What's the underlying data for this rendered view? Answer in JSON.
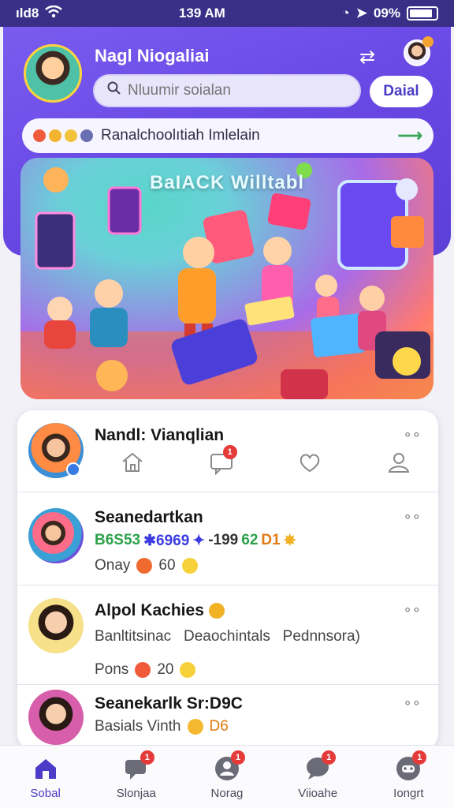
{
  "status_bar": {
    "time": "139 AM",
    "left": "ıld8",
    "battery": "09%"
  },
  "header": {
    "user_name": "Nagl Niogaliai",
    "search_placeholder": "Nluumir soialan",
    "deal_label": "Daial",
    "announcement": "Ranalchoolıtiah Imlelain"
  },
  "banner": {
    "title": "BaIACK Willtabl"
  },
  "feed": {
    "rows": [
      {
        "name": "Nandl: Vianqlian",
        "more": "∘∘"
      },
      {
        "name": "Seanedartkan",
        "stats_parts": [
          "B6S53",
          "✱6969",
          "✦",
          "-199",
          "62",
          "D1"
        ],
        "sub": "Onay",
        "sub_count": "60",
        "more": "∘∘"
      },
      {
        "name": "Alpol Kachies",
        "line": "Banltitsinac   Deaochintals   Pednnsora)",
        "sub": "Pons",
        "sub_count": "20",
        "more": "∘∘"
      },
      {
        "name": "Seanekarlk Sr:D9C",
        "sub": "Basials Vinth",
        "sub_tail": "D6",
        "more": "∘∘"
      }
    ]
  },
  "bottom_nav": [
    {
      "label": "Sobal",
      "icon": "home-icon",
      "active": true,
      "badge": ""
    },
    {
      "label": "Slonjaa",
      "icon": "chat-icon",
      "active": false,
      "badge": "1"
    },
    {
      "label": "Norag",
      "icon": "profile-icon",
      "active": false,
      "badge": "1"
    },
    {
      "label": "Viioahe",
      "icon": "message-icon",
      "active": false,
      "badge": "1"
    },
    {
      "label": "Iongrt",
      "icon": "game-icon",
      "active": false,
      "badge": "1"
    }
  ],
  "colors": {
    "brand": "#6948e4",
    "badge": "#e53a3a",
    "active_nav": "#4b3bc6"
  }
}
